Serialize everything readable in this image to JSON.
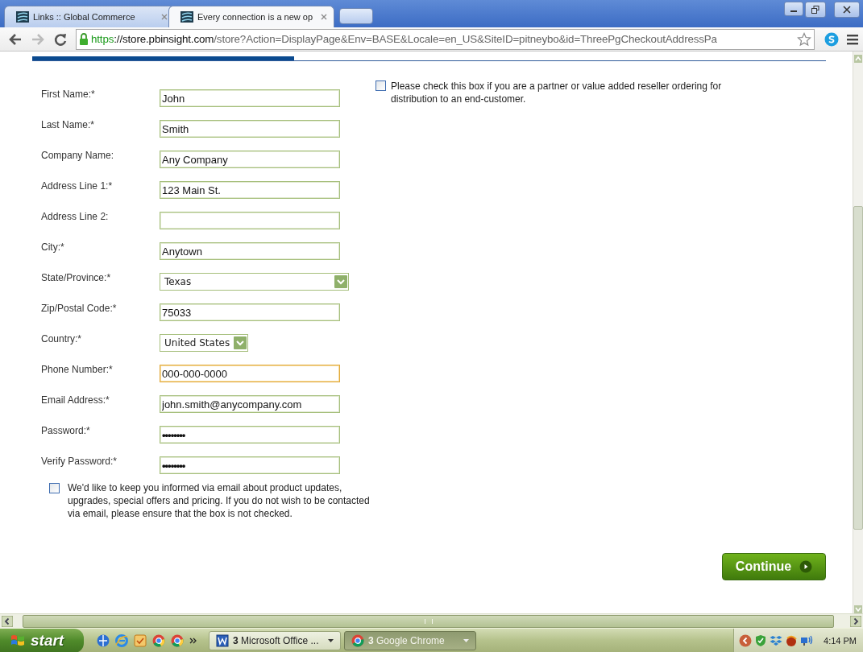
{
  "browser": {
    "tabs": [
      {
        "title": "Links :: Global Commerce",
        "selected": false
      },
      {
        "title": "Every connection is a new op",
        "selected": true
      }
    ],
    "address": {
      "scheme": "https",
      "host": "://store.pbinsight.com",
      "path": "/store?Action=DisplayPage&Env=BASE&Locale=en_US&SiteID=pitneybo&id=ThreePgCheckoutAddressPa"
    }
  },
  "checkout": {
    "progress": {
      "level": 0.33
    },
    "fields": [
      {
        "label": "First Name:*",
        "kind": "text",
        "value": "John",
        "focused": false
      },
      {
        "label": "Last Name:*",
        "kind": "text",
        "value": "Smith",
        "focused": false
      },
      {
        "label": "Company Name:",
        "kind": "text",
        "value": "Any Company",
        "focused": false
      },
      {
        "label": "Address Line 1:*",
        "kind": "text",
        "value": "123 Main St.",
        "focused": false
      },
      {
        "label": "Address Line 2:",
        "kind": "text",
        "focused": false
      },
      {
        "label": "City:*",
        "kind": "text",
        "value": "Anytown",
        "focused": false
      },
      {
        "label": "State/Province:*",
        "kind": "select",
        "value": "Texas",
        "focused": false
      },
      {
        "label": "Zip/Postal Code:*",
        "kind": "text",
        "value": "75033",
        "focused": false
      },
      {
        "label": "Country:*",
        "kind": "select",
        "value": "United States",
        "focused": false
      },
      {
        "label": "Phone Number:*",
        "kind": "text",
        "value": "000-000-0000",
        "focused": true
      },
      {
        "label": "Email Address:*",
        "kind": "text",
        "value": "john.smith@anycompany.com",
        "focused": false
      },
      {
        "label": "Password:*",
        "kind": "password",
        "value": "••••••••",
        "focused": false
      },
      {
        "label": "Verify Password:*",
        "kind": "password",
        "value": "••••••••",
        "focused": false
      }
    ],
    "newsletter": {
      "text": "We'd like to keep you informed via email about product updates, upgrades, special offers and pricing. If you do not wish to be contacted via email, please ensure that the box is not checked.",
      "checked": false
    },
    "partner": {
      "text": "Please check this box if you are a partner or value added reseller ordering for distribution to an end-customer.",
      "checked": false
    },
    "continue_button": {
      "label": "Continue"
    }
  },
  "taskbar": {
    "start": "start",
    "tasks": [
      {
        "count": "3",
        "label": "Microsoft Office ...",
        "selected": false
      },
      {
        "count": "3",
        "label": "Google Chrome",
        "selected": true
      }
    ],
    "clock": "4:14 PM"
  }
}
